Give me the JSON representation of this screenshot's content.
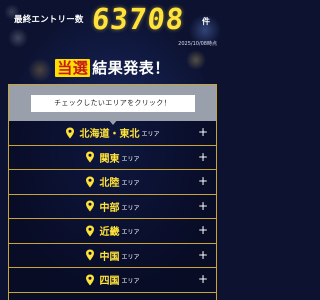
{
  "header": {
    "entry_label": "最終エントリー数",
    "entry_count": "63708",
    "entry_unit": "件",
    "date_stamp": "2025/10/08時点"
  },
  "title": {
    "highlight": "当選",
    "rest": "結果発表！"
  },
  "panel": {
    "prompt": "チェックしたいエリアをクリック！",
    "areas": [
      {
        "name": "北海道・東北",
        "suffix": "エリア"
      },
      {
        "name": "関東",
        "suffix": "エリア"
      },
      {
        "name": "北陸",
        "suffix": "エリア"
      },
      {
        "name": "中部",
        "suffix": "エリア"
      },
      {
        "name": "近畿",
        "suffix": "エリア"
      },
      {
        "name": "中国",
        "suffix": "エリア"
      },
      {
        "name": "四国",
        "suffix": "エリア"
      }
    ],
    "expand_glyph": "+"
  },
  "colors": {
    "accent": "#ffe23a",
    "border": "#c9a437",
    "highlight_bg": "#ffde00",
    "highlight_text": "#c41a1a",
    "background": "#0c1230"
  },
  "icons": {
    "area_marker": "map-pin-icon",
    "expand": "plus-icon"
  }
}
